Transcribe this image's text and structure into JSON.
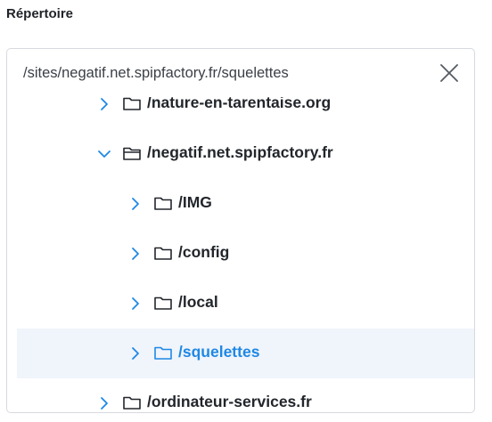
{
  "field": {
    "label": "Répertoire"
  },
  "input": {
    "value": "/sites/negatif.net.spipfactory.fr/squelettes"
  },
  "tree": {
    "items": [
      {
        "label": "/nature-en-tarentaise.org",
        "level": 1,
        "expanded": false,
        "selected": false,
        "icon": "folder-icon"
      },
      {
        "label": "/negatif.net.spipfactory.fr",
        "level": 1,
        "expanded": true,
        "selected": false,
        "icon": "folder-open-icon"
      },
      {
        "label": "/IMG",
        "level": 2,
        "expanded": false,
        "selected": false,
        "icon": "folder-icon"
      },
      {
        "label": "/config",
        "level": 2,
        "expanded": false,
        "selected": false,
        "icon": "folder-icon"
      },
      {
        "label": "/local",
        "level": 2,
        "expanded": false,
        "selected": false,
        "icon": "folder-icon"
      },
      {
        "label": "/squelettes",
        "level": 2,
        "expanded": false,
        "selected": true,
        "icon": "folder-icon"
      },
      {
        "label": "/ordinateur-services.fr",
        "level": 1,
        "expanded": false,
        "selected": false,
        "icon": "folder-icon"
      }
    ]
  },
  "colors": {
    "accent": "#1e88e5",
    "selected_bg": "#f0f4fb",
    "text": "#22262b"
  }
}
